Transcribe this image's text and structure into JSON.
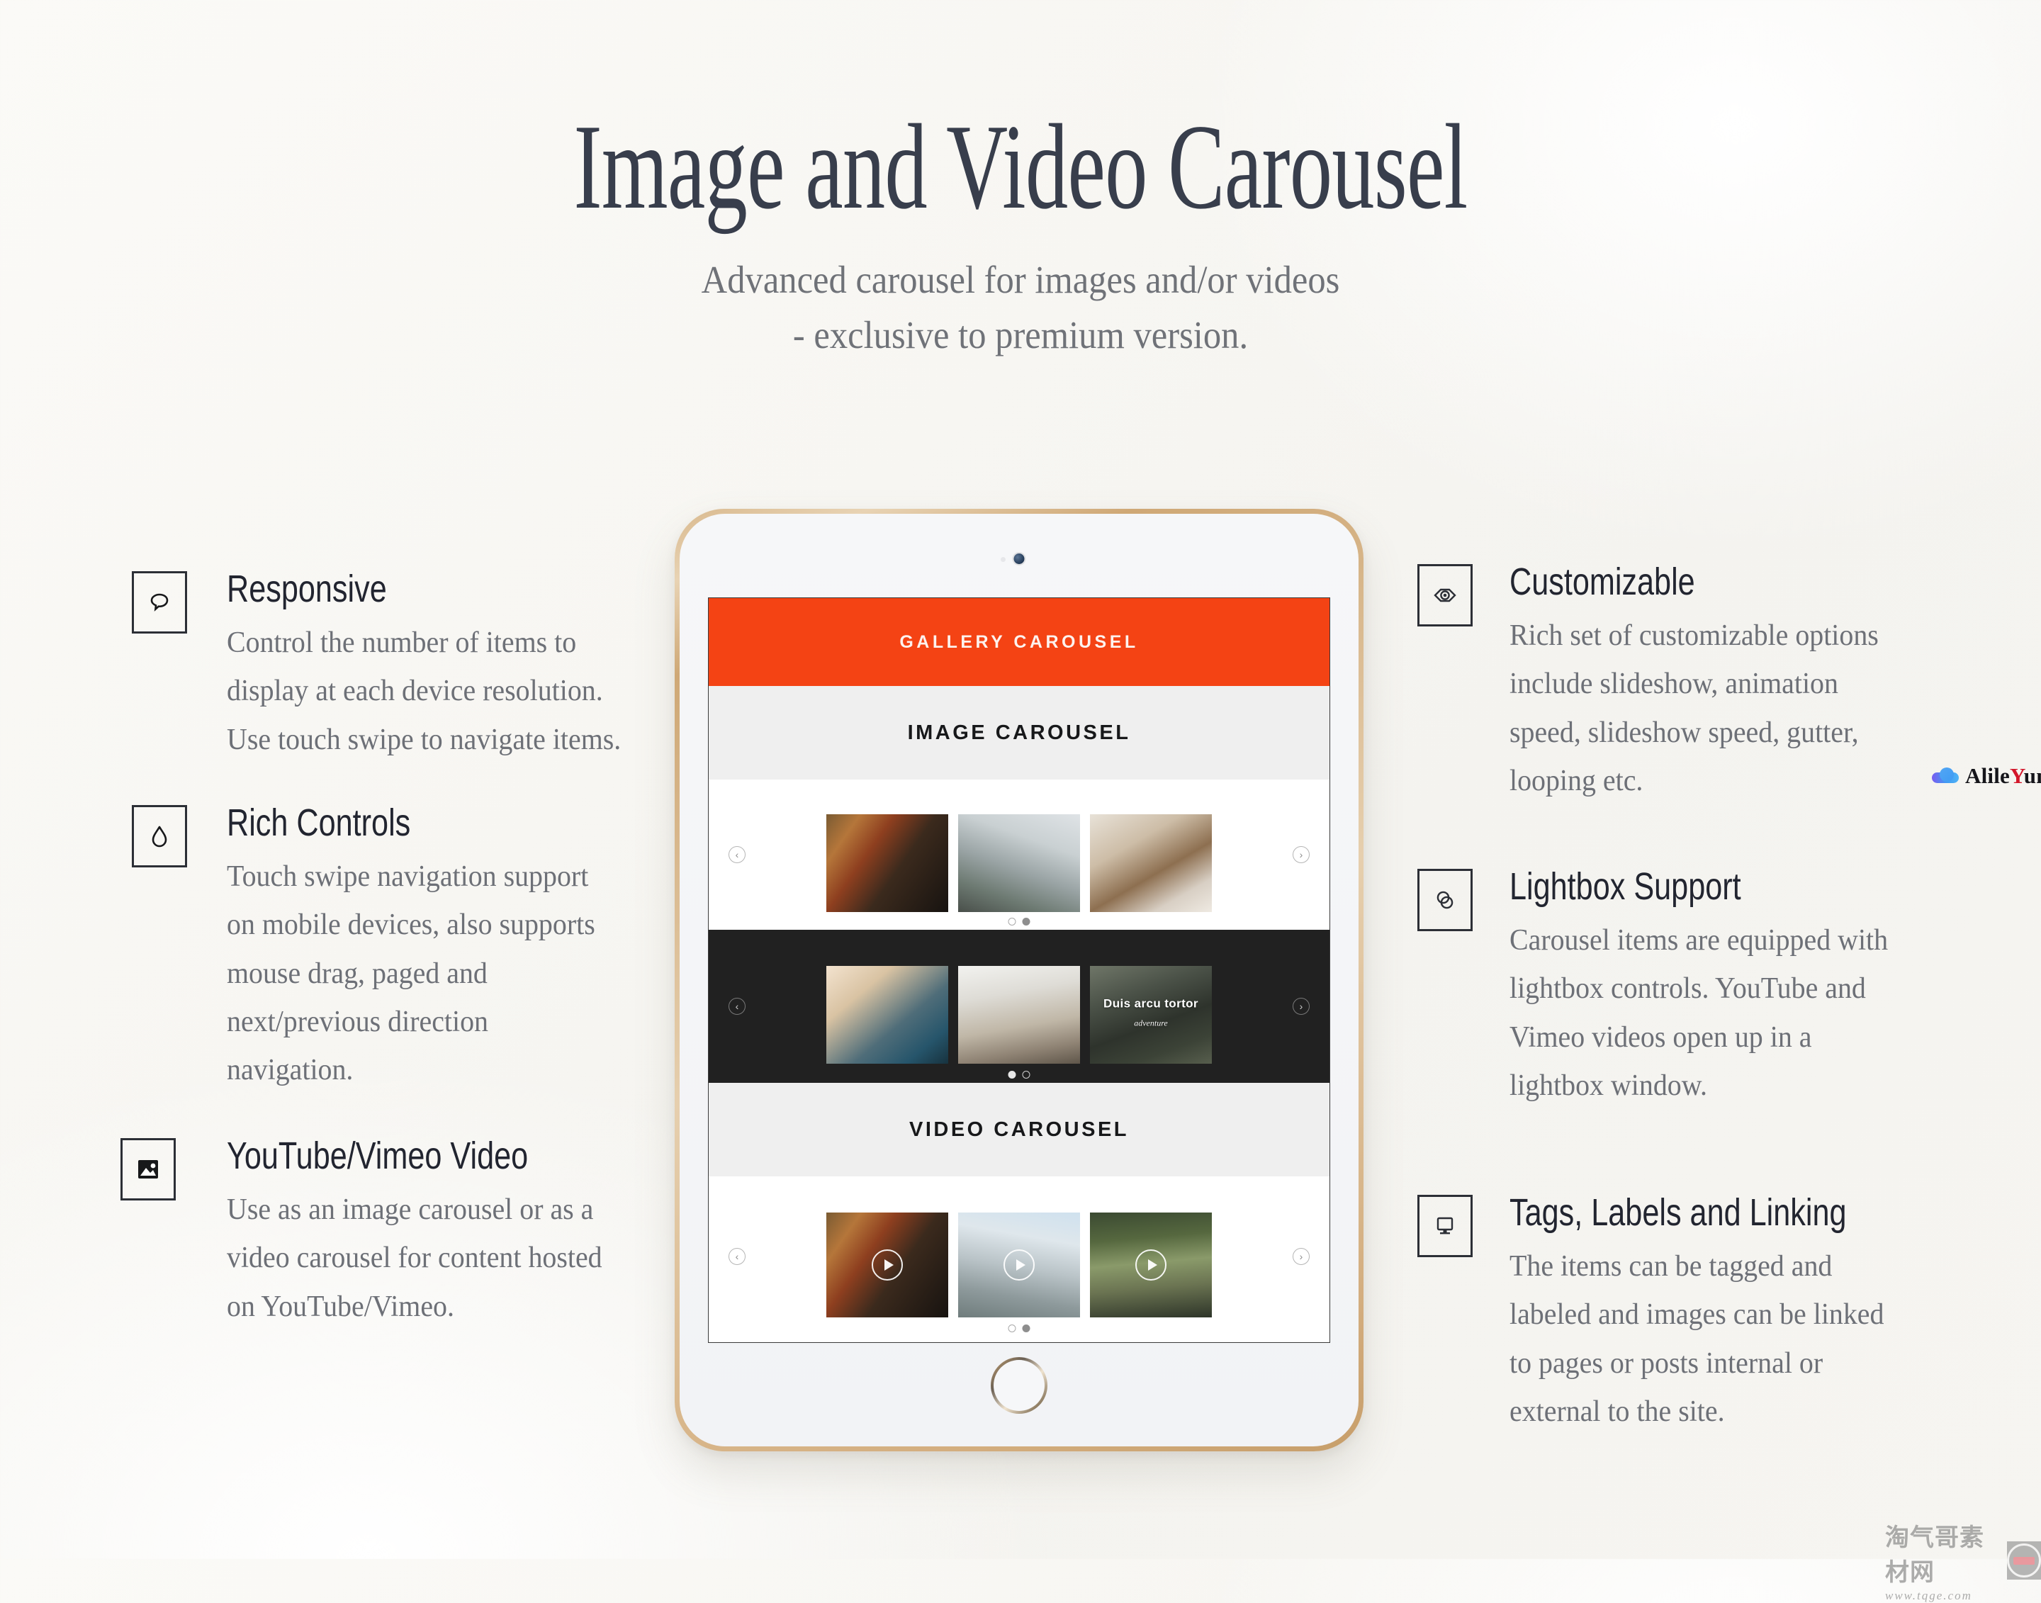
{
  "hero": {
    "title": "Image and Video Carousel",
    "subtitle_line1": "Advanced carousel for images and/or videos",
    "subtitle_line2": "- exclusive to premium version."
  },
  "colors": {
    "accent_orange": "#f44314",
    "title_ink": "#383e4c",
    "body_gray": "#6d7077",
    "dark_band": "#212121",
    "gray_band": "#efefef",
    "tablet_bezel_gold": "#d3ad7e"
  },
  "features_left": [
    {
      "icon": "speech-bubble-icon",
      "title": "Responsive",
      "body": "Control the number of items to display at each device resolution. Use touch swipe to navigate items."
    },
    {
      "icon": "droplet-icon",
      "title": "Rich Controls",
      "body": "Touch swipe navigation support on mobile devices, also supports mouse drag, paged and next/previous direction navigation."
    },
    {
      "icon": "image-icon",
      "title": "YouTube/Vimeo Video",
      "body": "Use as an image carousel or as a video carousel  for content hosted on YouTube/Vimeo."
    }
  ],
  "features_right": [
    {
      "icon": "eye-icon",
      "title": "Customizable",
      "body": "Rich set of customizable options include slideshow, animation speed, slideshow speed, gutter, looping etc."
    },
    {
      "icon": "overlapping-circles-icon",
      "title": "Lightbox Support",
      "body": "Carousel items are equipped with lightbox controls. YouTube and Vimeo videos open up in a lightbox window."
    },
    {
      "icon": "monitor-icon",
      "title": "Tags, Labels and Linking",
      "body": "The items can be tagged and labeled and images can be linked to pages or posts internal or external to the site."
    }
  ],
  "tablet": {
    "device": "tablet-gold",
    "screen": {
      "orange_bar_label": "GALLERY CAROUSEL",
      "image_section_label": "IMAGE CAROUSEL",
      "video_section_label": "VIDEO CAROUSEL",
      "carousels": [
        {
          "name": "image-carousel-light",
          "theme": "light",
          "prev_label": "‹",
          "next_label": "›",
          "dots": [
            "off",
            "on"
          ],
          "items": [
            {
              "photo": "guitar-player",
              "caption": "",
              "label": ""
            },
            {
              "photo": "runner-street",
              "caption": "",
              "label": ""
            },
            {
              "photo": "desk-papers",
              "caption": "",
              "label": ""
            }
          ]
        },
        {
          "name": "image-carousel-dark",
          "theme": "dark",
          "prev_label": "‹",
          "next_label": "›",
          "dots": [
            "on",
            "off"
          ],
          "items": [
            {
              "photo": "coffee-sofa",
              "caption": "",
              "label": ""
            },
            {
              "photo": "kitchen-woman",
              "caption": "",
              "label": ""
            },
            {
              "photo": "motorbike-forest",
              "caption": "Duis arcu tortor",
              "label": "adventure"
            }
          ]
        },
        {
          "name": "video-carousel",
          "theme": "light",
          "prev_label": "‹",
          "next_label": "›",
          "dots": [
            "off",
            "on"
          ],
          "items": [
            {
              "photo": "guitar-player",
              "caption": "",
              "label": "",
              "play": true
            },
            {
              "photo": "city-skyline",
              "caption": "",
              "label": "",
              "play": true
            },
            {
              "photo": "forest-road",
              "caption": "",
              "label": "",
              "play": true
            }
          ]
        }
      ]
    }
  },
  "watermarks": {
    "alileyun": {
      "text_a": "Alile",
      "text_y": "Y",
      "text_b": "un"
    },
    "tqge": {
      "cn": "淘气哥素材网",
      "url": "www.tqge.com"
    }
  }
}
